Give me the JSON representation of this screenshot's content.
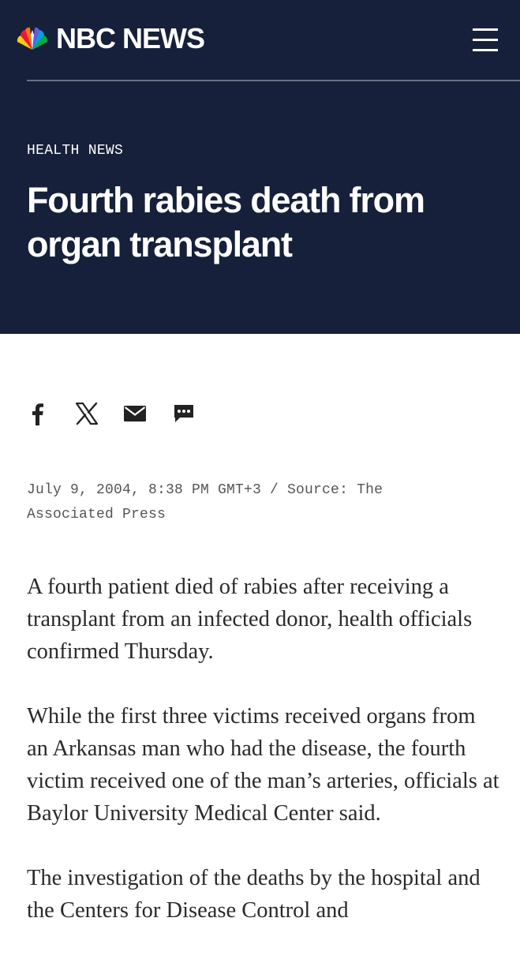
{
  "brand": {
    "name": "NBC NEWS",
    "accent": "#17203a"
  },
  "header": {
    "menu_icon": "hamburger-menu-icon"
  },
  "article": {
    "section": "HEALTH NEWS",
    "headline": "Fourth rabies death from organ transplant",
    "meta": "July 9, 2004, 8:38 PM GMT+3 / Source: The Associated Press",
    "paragraphs": [
      "A fourth patient died of rabies after receiving a transplant from an infected donor, health officials confirmed Thursday.",
      "While the first three victims received organs from an Arkansas man who had the disease, the fourth victim received one of the man’s arteries, officials at Baylor University Medical Center said.",
      "The investigation of the deaths by the hospital and the Centers for Disease Control and"
    ]
  },
  "share": {
    "icons": [
      "facebook-icon",
      "x-icon",
      "email-icon",
      "more-comments-icon"
    ]
  }
}
